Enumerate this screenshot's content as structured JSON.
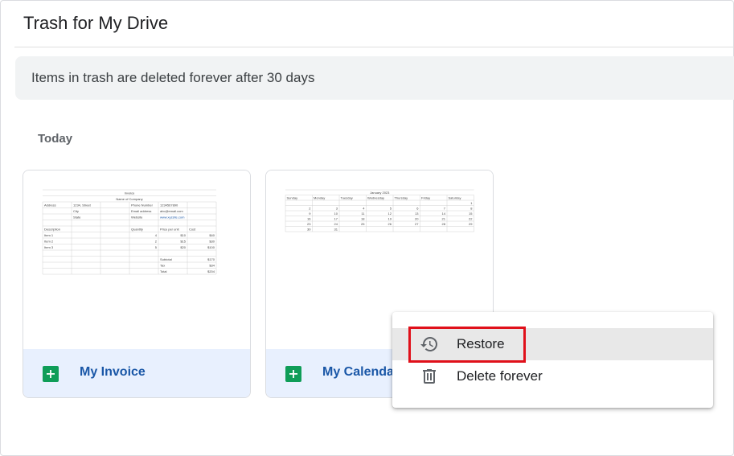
{
  "header": {
    "title": "Trash for My Drive"
  },
  "banner": {
    "text": "Items in trash are deleted forever after 30 days"
  },
  "section": {
    "heading": "Today"
  },
  "files": [
    {
      "name": "My Invoice",
      "icon": "google-sheets-icon",
      "thumbnail": {
        "title": "Invoice",
        "company": "Name of Company",
        "rows": [
          [
            "Address",
            "1234, Street",
            "Phone Number",
            "1234567890"
          ],
          [
            "",
            "City",
            "Email address",
            "abc@email.com"
          ],
          [
            "",
            "State",
            "Website",
            "www.xyzsite.com"
          ]
        ],
        "headers": [
          "Description",
          "Quantity",
          "Price per unit",
          "Cost"
        ],
        "items": [
          [
            "Item 1",
            "4",
            "$10",
            "$40"
          ],
          [
            "Item 2",
            "2",
            "$15",
            "$30"
          ],
          [
            "Item 3",
            "5",
            "$20",
            "$100"
          ]
        ],
        "totals": [
          [
            "Subtotal",
            "$170"
          ],
          [
            "Tax",
            "$34"
          ],
          [
            "Total",
            "$204"
          ]
        ]
      }
    },
    {
      "name": "My Calendar",
      "visible_name": "My Calenda",
      "icon": "google-sheets-icon",
      "thumbnail": {
        "title": "January 2023",
        "days": [
          "Sunday",
          "Monday",
          "Tuesday",
          "Wednesday",
          "Thursday",
          "Friday",
          "Saturday"
        ],
        "weeks": [
          [
            "",
            "",
            "",
            "",
            "",
            "",
            "1"
          ],
          [
            "2",
            "3",
            "4",
            "5",
            "6",
            "7",
            "8"
          ],
          [
            "9",
            "10",
            "11",
            "12",
            "13",
            "14",
            "15"
          ],
          [
            "16",
            "17",
            "18",
            "19",
            "20",
            "21",
            "22"
          ],
          [
            "23",
            "24",
            "25",
            "26",
            "27",
            "28",
            "29"
          ],
          [
            "30",
            "31",
            "",
            "",
            "",
            "",
            ""
          ]
        ]
      }
    }
  ],
  "context_menu": {
    "items": [
      {
        "label": "Restore",
        "icon": "restore-history-icon"
      },
      {
        "label": "Delete forever",
        "icon": "trash-icon"
      }
    ]
  },
  "colors": {
    "accent": "#1a57a7",
    "highlight": "#e0101a",
    "sheets": "#0f9d58",
    "banner": "#f1f3f4",
    "card_footer": "#e8f0fe"
  }
}
